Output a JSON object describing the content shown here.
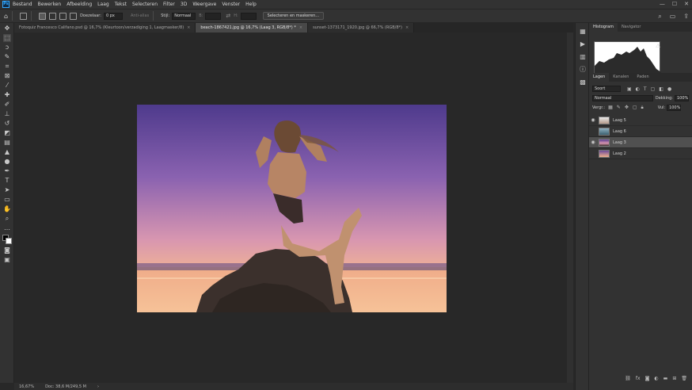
{
  "app": {
    "logo_text": "Ps"
  },
  "menu": [
    "Bestand",
    "Bewerken",
    "Afbeelding",
    "Laag",
    "Tekst",
    "Selecteren",
    "Filter",
    "3D",
    "Weergave",
    "Venster",
    "Help"
  ],
  "window_controls": {
    "minimize": "—",
    "maximize": "☐",
    "close": "✕"
  },
  "options": {
    "feather_label": "Doezelaar:",
    "feather_value": "0 px",
    "antialias_label": "Anti-alias",
    "style_label": "Stijl:",
    "style_value": "Normaal",
    "width_label": "B:",
    "height_label": "H:",
    "select_mask_label": "Selecteren en maskeren..."
  },
  "tabs": [
    {
      "label": "Fotoquiz Francesco Califano.psd @ 16,7% (Kleurtoon/verzadiging 1, Laagmasker/8)",
      "active": false
    },
    {
      "label": "beach-1867421.jpg @ 16,7% (Laag 3, RGB/8*) *",
      "active": true
    },
    {
      "label": "sunset-1373171_1920.jpg @ 66,7% (RGB/8*)",
      "active": false
    }
  ],
  "status": {
    "zoom": "16,67%",
    "doc": "Doc: 38,6 M/249,5 M"
  },
  "panels": {
    "top_tabs": [
      "Histogram",
      "Navigator"
    ],
    "layer_tabs": [
      "Lagen",
      "Kanalen",
      "Paden"
    ],
    "kind_filter": "Soort",
    "blend_mode": "Normaal",
    "opacity_label": "Dekking:",
    "opacity_value": "100%",
    "lock_label": "Vergr.:",
    "fill_label": "Vul:",
    "fill_value": "100%"
  },
  "layers": [
    {
      "name": "Laag 5",
      "visible": true,
      "selected": false
    },
    {
      "name": "Laag 6",
      "visible": false,
      "selected": false
    },
    {
      "name": "Laag 3",
      "visible": true,
      "selected": true
    },
    {
      "name": "Laag 2",
      "visible": false,
      "selected": false
    }
  ],
  "colors": {
    "sky_top": "#5a3f91",
    "sky_mid": "#a673b8",
    "sky_horizon": "#f0b08c",
    "water": "#f4b98f",
    "rock": "#3a2f2c",
    "accent": "#31a8ff"
  }
}
